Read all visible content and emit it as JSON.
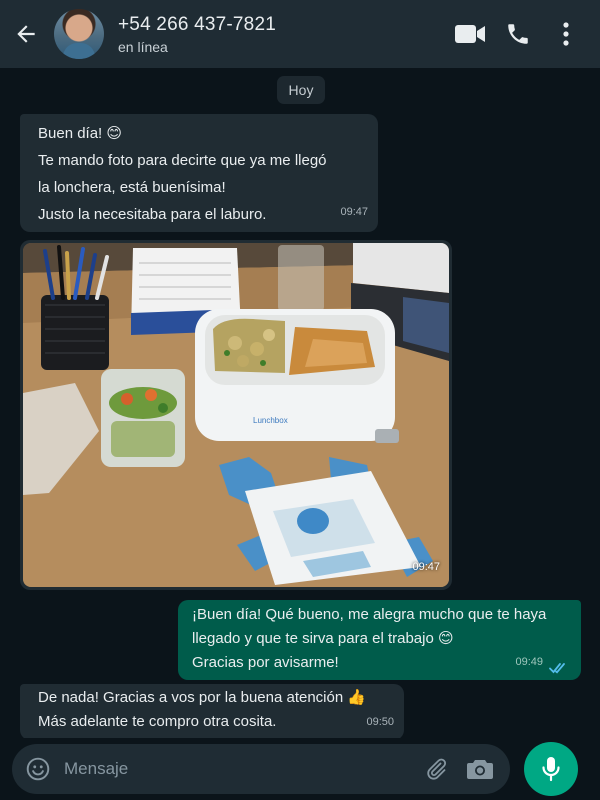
{
  "contact": {
    "name": "+54 266 437-7821",
    "status": "en línea"
  },
  "icons": {
    "back": "back-arrow-icon",
    "video": "video-call-icon",
    "call": "phone-icon",
    "menu": "more-vertical-icon",
    "emoji": "emoji-icon",
    "attach": "paperclip-icon",
    "camera": "camera-icon",
    "mic": "microphone-icon"
  },
  "chat": {
    "date": "Hoy",
    "messages": [
      {
        "direction": "in",
        "lines": [
          "Buen día! 😊",
          "Te mando foto para decirte que ya me llegó",
          "la lonchera, está buenísima!",
          "Justo la necesitaba para el laburo."
        ],
        "time": "09:47"
      },
      {
        "direction": "in",
        "type": "image",
        "time": "09:47"
      },
      {
        "direction": "out",
        "lines": [
          "¡Buen día! Qué bueno, me alegra mucho que te haya",
          "llegado y que te sirva para el trabajo 😊",
          "Gracias por avisarme!"
        ],
        "time": "09:49",
        "read": true
      },
      {
        "direction": "in",
        "lines": [
          "De nada! Gracias a vos por la buena atención 👍",
          "Más adelante te compro otra cosita."
        ],
        "time": "09:50"
      }
    ]
  },
  "composer": {
    "placeholder": "Mensaje"
  },
  "colors": {
    "background": "#0b141a",
    "header": "#1f2c34",
    "incoming": "#202c33",
    "outgoing": "#005c4b",
    "accent": "#00a884",
    "read_ticks": "#53bdeb"
  }
}
